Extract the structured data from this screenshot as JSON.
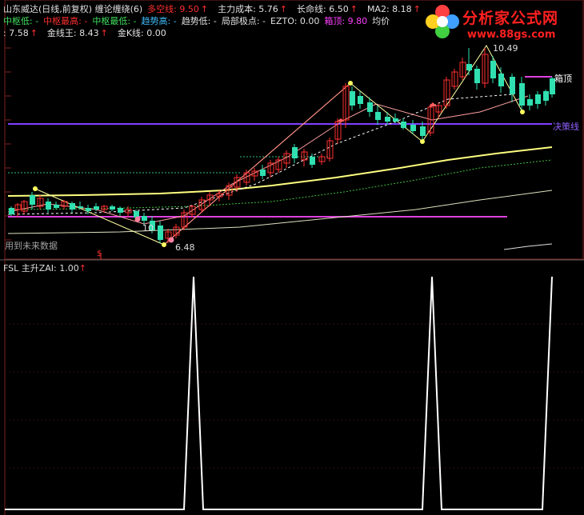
{
  "header": {
    "line1": [
      {
        "label": "山东威达(日线,前复权) 缠论缠绕(6)",
        "color": "#e0e0e0"
      },
      {
        "label": "多空线: 9.50",
        "color": "#ff3030",
        "arrow": true
      },
      {
        "label": "主力成本: 5.76",
        "color": "#e0e0e0",
        "arrow": true
      },
      {
        "label": "长命线: 6.50",
        "color": "#e0e0e0",
        "arrow": true
      },
      {
        "label": "MA2: 8.18",
        "color": "#e0e0e0",
        "arrow": true
      }
    ],
    "line2": [
      {
        "label": "中枢低: -",
        "color": "#40e060"
      },
      {
        "label": "中枢最高: -",
        "color": "#ff3030"
      },
      {
        "label": "中枢最低: -",
        "color": "#40e060"
      },
      {
        "label": "趋势高: -",
        "color": "#40c0ff"
      },
      {
        "label": "趋势低: -",
        "color": "#e0e0e0"
      },
      {
        "label": "局部极点: -",
        "color": "#e0e0e0"
      },
      {
        "label": "EZTO: 0.00",
        "color": "#e0e0e0"
      },
      {
        "label": "箱顶: 9.80",
        "color": "#ff40ff"
      },
      {
        "label": "均价",
        "color": "#e0e0e0"
      }
    ],
    "line3": [
      {
        "label": ": 7.58",
        "color": "#e0e0e0",
        "arrow": true
      },
      {
        "label": "金线王: 8.43",
        "color": "#e0e0e0",
        "arrow": true
      },
      {
        "label": "金K线: 0.00",
        "color": "#e0e0e0"
      }
    ]
  },
  "logo": {
    "title": "分析家公式网",
    "url": "www.88gs.com"
  },
  "annotations": {
    "high_price": "10.49",
    "low_price": "6.48",
    "mid_label": "10",
    "box_top": "箱顶",
    "decision_line": "决策线",
    "future_data": "用到未来数据",
    "dollar": "$"
  },
  "lower_panel": {
    "header": "FSL  主升ZAI: 1.00",
    "arrow": true,
    "signal_peaks": [
      1,
      1,
      1
    ]
  },
  "colors": {
    "background": "#000000",
    "grid": "#802020",
    "up_candle": "#ff3030",
    "down_candle": "#30e0b0",
    "yellow_line": "#ffff80",
    "purple_line": "#8040ff",
    "magenta_line": "#e040e0",
    "signal": "#ffffff"
  }
}
